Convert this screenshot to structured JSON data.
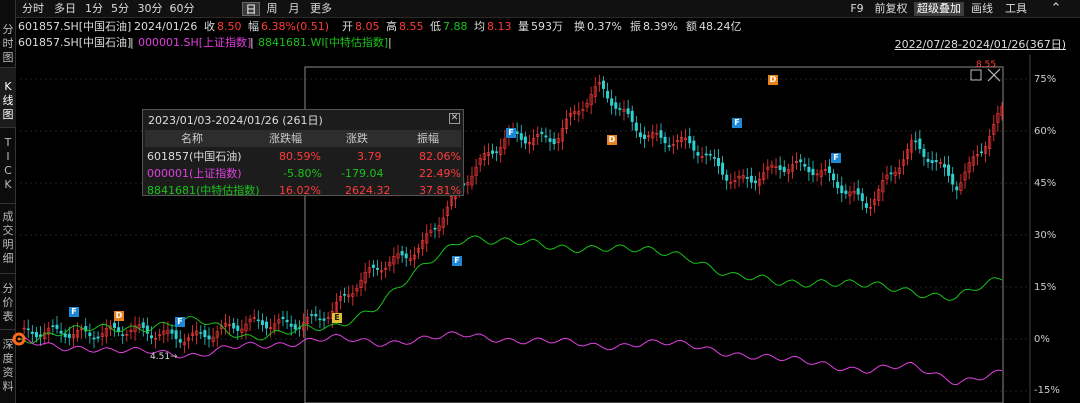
{
  "left_tabs": [
    "分\n时\n图",
    "K\n线\n图",
    "T\nI\nC\nK",
    "成\n交\n明\n细",
    "分\n价\n表",
    "深\n度\n资\n料"
  ],
  "toolbar": {
    "periods": [
      "分时",
      "多日",
      "1分",
      "5分",
      "30分",
      "60分",
      "日",
      "周",
      "月",
      "更多"
    ],
    "active": "日",
    "right": [
      "F9",
      "前复权",
      "超级叠加",
      "画线",
      "工具"
    ],
    "highlighted": "超级叠加"
  },
  "quote": {
    "code": "601857.SH[中国石油]",
    "date": "2024/01/26",
    "close_label": "收",
    "close": "8.50",
    "change_label": "幅",
    "change": "6.38%(0.51)",
    "open_label": "开",
    "open": "8.05",
    "high_label": "高",
    "high": "8.55",
    "low_label": "低",
    "low": "7.88",
    "avg_label": "均",
    "avg": "8.13",
    "vol_label": "量",
    "vol": "593万",
    "turnover_label": "换",
    "turnover": "0.37%",
    "amp_label": "振",
    "amp": "8.39%",
    "amount_label": "额",
    "amount": "48.24亿"
  },
  "legend": {
    "main": "601857.SH[中国石油]",
    "sep": "|",
    "s2": "000001.SH[上证指数]",
    "s3": "8841681.WI[中特估指数]",
    "range": "2022/07/28-2024/01/26(367日)"
  },
  "popup": {
    "title": "2023/01/03-2024/01/26 (261日)",
    "close": "✕",
    "headers": [
      "名称",
      "涨跌幅",
      "涨跌",
      "振幅"
    ],
    "rows": [
      {
        "name": "601857(中国石油)",
        "pct": "80.59%",
        "chg": "3.79",
        "amp": "82.06%"
      },
      {
        "name": "000001(上证指数)",
        "pct": "-5.80%",
        "chg": "-179.04",
        "amp": "22.49%"
      },
      {
        "name": "8841681(中特估指数)",
        "pct": "16.02%",
        "chg": "2624.32",
        "amp": "37.81%"
      }
    ]
  },
  "annotations": {
    "price_high": "8.55",
    "price_low": "4.51"
  },
  "chart_data": {
    "type": "line",
    "yaxis_labels": [
      "75%",
      "60%",
      "45%",
      "30%",
      "15%",
      "0%",
      "-15%"
    ],
    "yaxis_values": [
      75,
      60,
      45,
      30,
      15,
      0,
      -15
    ],
    "ylim": [
      -17,
      80
    ],
    "x": [
      0,
      10,
      20,
      30,
      40,
      50,
      60,
      70,
      80,
      90,
      100
    ],
    "series": [
      {
        "name": "601857.SH[中国石油]",
        "color": "#ff3b3b",
        "values": [
          0,
          3,
          2,
          1,
          2,
          3,
          5,
          8,
          20,
          28,
          45,
          60,
          58,
          72,
          60,
          55,
          46,
          50,
          47,
          40,
          55,
          45,
          66
        ]
      },
      {
        "name": "000001.SH[上证指数]",
        "color": "#e040e0",
        "values": [
          0,
          -2,
          -4,
          -3,
          -5,
          -2,
          -1,
          0,
          -1,
          0,
          1,
          0,
          -1,
          -2,
          -1,
          -2,
          -4,
          -6,
          -7,
          -9,
          -8,
          -12,
          -10
        ]
      },
      {
        "name": "8841681.WI[中特估指数]",
        "color": "#19c219",
        "values": [
          0,
          2,
          3,
          4,
          5,
          1,
          2,
          3,
          10,
          20,
          30,
          28,
          26,
          27,
          25,
          24,
          18,
          16,
          17,
          15,
          14,
          12,
          17
        ]
      }
    ]
  },
  "colors": {
    "up": "#ff3b3b",
    "down": "#19c219",
    "index": "#e040e0",
    "bg": "#000000"
  }
}
